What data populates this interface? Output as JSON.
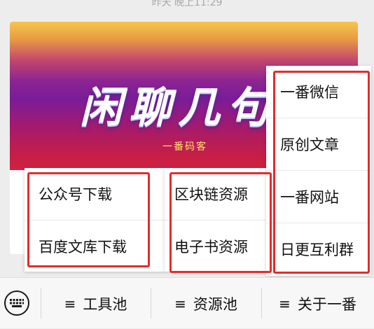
{
  "chat": {
    "timestamp": "昨天 晚上11:29"
  },
  "article": {
    "banner_title": "闲聊几句",
    "banner_subtitle": "一番码客"
  },
  "popups": {
    "tools": [
      "公众号下载",
      "百度文库下载"
    ],
    "resources": [
      "区块链资源",
      "电子书资源"
    ],
    "about": [
      "一番微信",
      "原创文章",
      "一番网站",
      "日更互利群"
    ]
  },
  "bottom_bar": {
    "menu_glyph": "≡",
    "tools_label": "工具池",
    "resources_label": "资源池",
    "about_label": "关于一番"
  },
  "colors": {
    "highlight": "#e52b2b",
    "bar_background": "#f7f7f7"
  }
}
